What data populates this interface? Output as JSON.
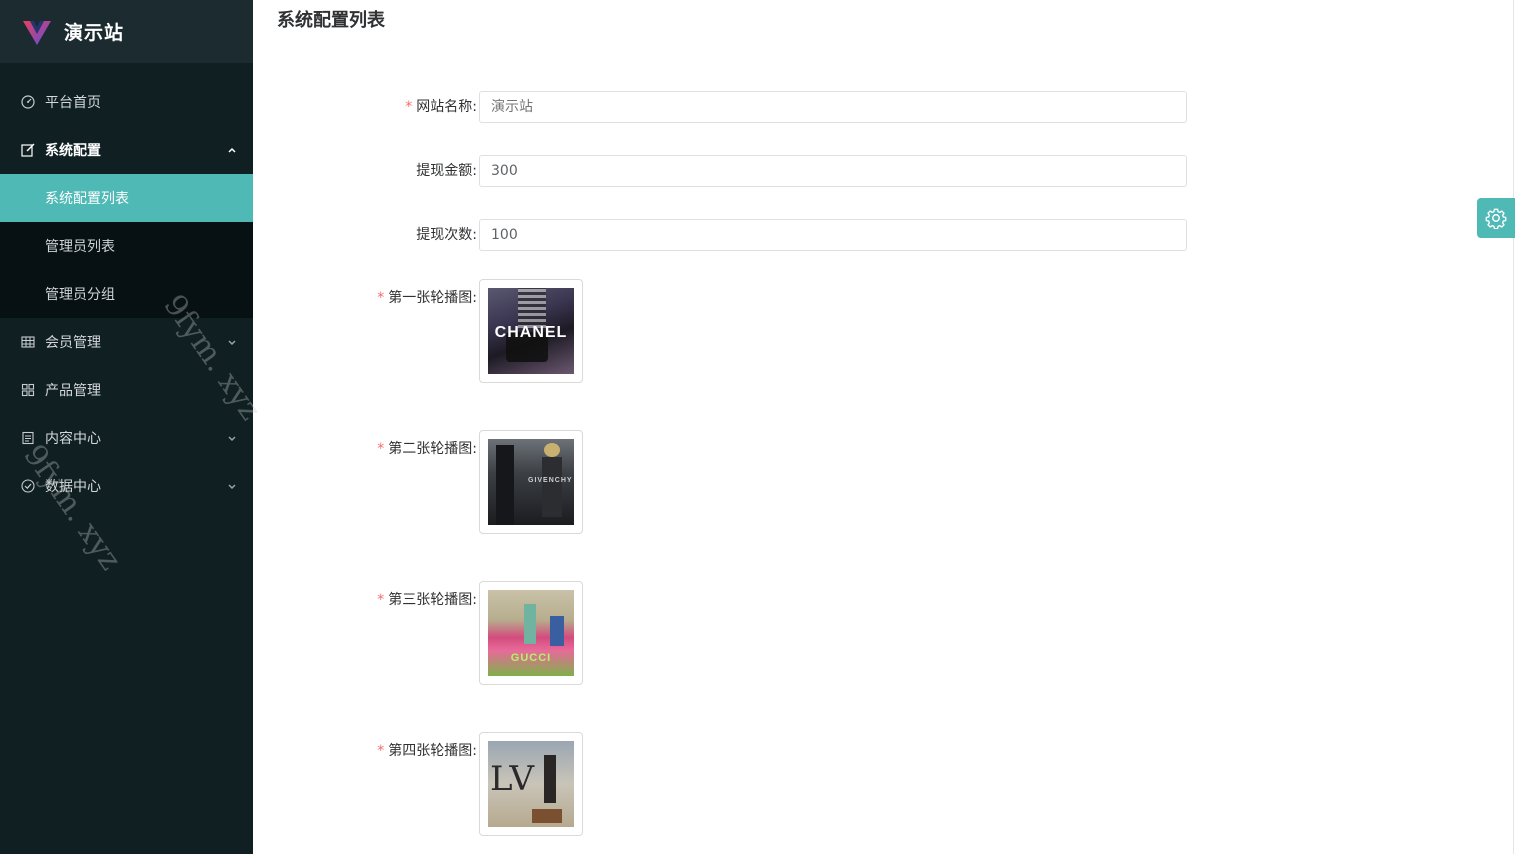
{
  "app": {
    "name": "演示站"
  },
  "sidebar": {
    "items": [
      {
        "label": "平台首页",
        "icon": "dashboard-icon",
        "expandable": false
      },
      {
        "label": "系统配置",
        "icon": "edit-icon",
        "expandable": true,
        "open": true,
        "children": [
          {
            "label": "系统配置列表",
            "active": true
          },
          {
            "label": "管理员列表",
            "active": false
          },
          {
            "label": "管理员分组",
            "active": false
          }
        ]
      },
      {
        "label": "会员管理",
        "icon": "grid-icon",
        "expandable": true
      },
      {
        "label": "产品管理",
        "icon": "apps-icon",
        "expandable": false
      },
      {
        "label": "内容中心",
        "icon": "document-icon",
        "expandable": true
      },
      {
        "label": "数据中心",
        "icon": "check-circle-icon",
        "expandable": true
      }
    ]
  },
  "main": {
    "title": "系统配置列表",
    "fields": [
      {
        "label": "网站名称:",
        "required": true,
        "placeholder": "演示站",
        "value": ""
      },
      {
        "label": "提现金额:",
        "required": false,
        "value": "300"
      },
      {
        "label": "提现次数:",
        "required": false,
        "value": "100"
      }
    ],
    "carousel": [
      {
        "label": "第一张轮播图:",
        "required": true,
        "caption": "CHANEL"
      },
      {
        "label": "第二张轮播图:",
        "required": true,
        "caption": "GIVENCHY"
      },
      {
        "label": "第三张轮播图:",
        "required": true,
        "caption": "GUCCI"
      },
      {
        "label": "第四张轮播图:",
        "required": true,
        "caption": "LV"
      }
    ]
  },
  "watermark": "9fym. xyz",
  "colors": {
    "accent": "#4fb9b6",
    "sidebar_bg": "#0f1f22",
    "required": "#f56c6c"
  }
}
